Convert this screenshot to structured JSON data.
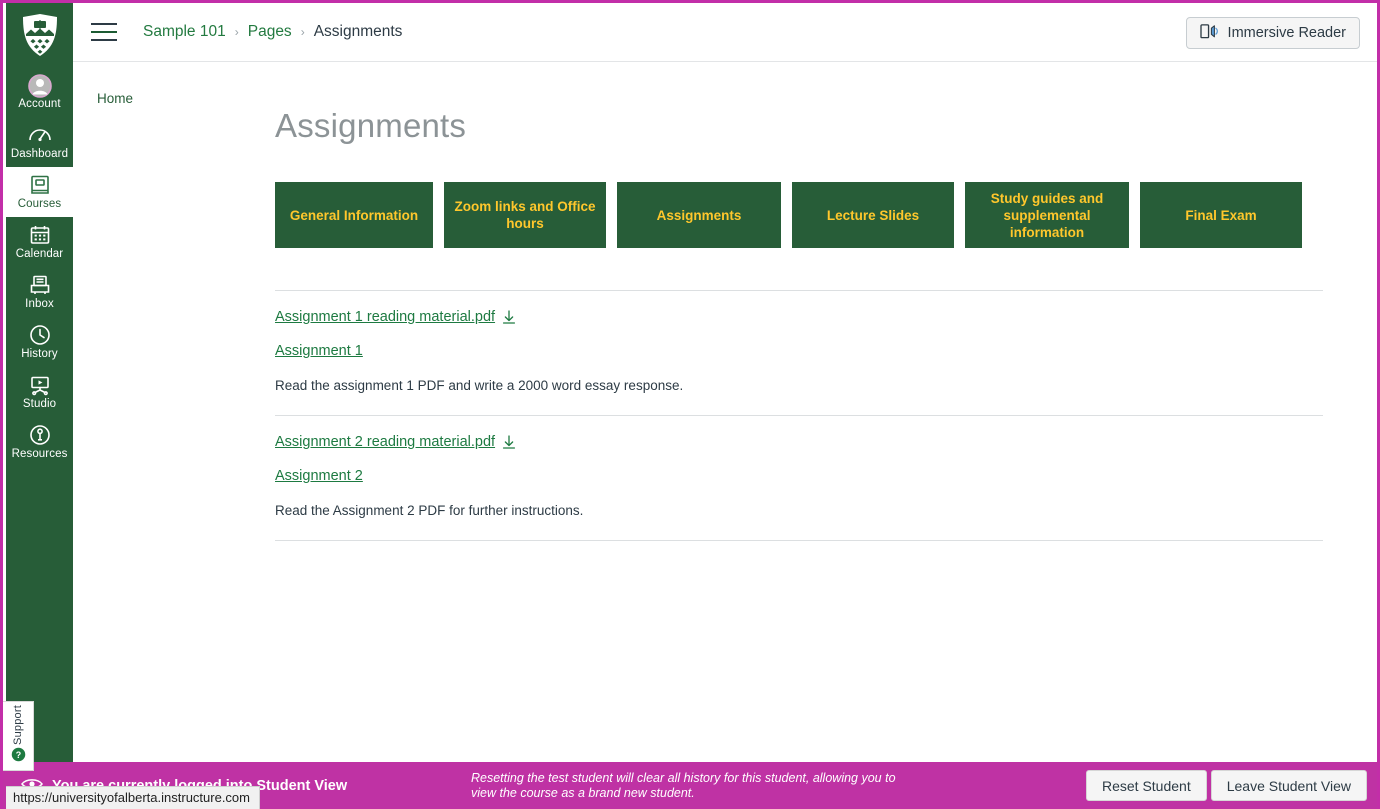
{
  "globalnav": {
    "logo_name": "university-of-alberta-shield",
    "items": [
      {
        "label": "Account",
        "icon": "account-icon",
        "active": false
      },
      {
        "label": "Dashboard",
        "icon": "dashboard-icon",
        "active": false
      },
      {
        "label": "Courses",
        "icon": "courses-icon",
        "active": true
      },
      {
        "label": "Calendar",
        "icon": "calendar-icon",
        "active": false
      },
      {
        "label": "Inbox",
        "icon": "inbox-icon",
        "active": false
      },
      {
        "label": "History",
        "icon": "history-icon",
        "active": false
      },
      {
        "label": "Studio",
        "icon": "studio-icon",
        "active": false
      },
      {
        "label": "Resources",
        "icon": "resources-icon",
        "active": false
      }
    ],
    "support_label": "Support"
  },
  "header": {
    "menu_icon": "hamburger-icon",
    "breadcrumb": [
      {
        "label": "Sample 101",
        "link": true
      },
      {
        "label": "Pages",
        "link": true
      },
      {
        "label": "Assignments",
        "link": false
      }
    ],
    "separator": "›",
    "immersive_reader_label": "Immersive Reader"
  },
  "coursenav": {
    "items": [
      {
        "label": "Home"
      }
    ]
  },
  "main": {
    "title": "Assignments",
    "buttons": [
      {
        "label": "General Information"
      },
      {
        "label": "Zoom links and Office hours"
      },
      {
        "label": "Assignments"
      },
      {
        "label": "Lecture Slides"
      },
      {
        "label": "Study guides and supplemental information"
      },
      {
        "label": "Final Exam"
      }
    ],
    "blocks": [
      {
        "file_label": "Assignment 1 reading material.pdf",
        "assignment_label": "Assignment 1",
        "description": "Read the assignment 1 PDF and write a 2000 word essay response."
      },
      {
        "file_label": "Assignment 2 reading material.pdf",
        "assignment_label": "Assignment 2",
        "description": "Read the Assignment 2 PDF for further instructions."
      }
    ]
  },
  "studentbar": {
    "notice": "You are currently logged into Student View",
    "info": "Resetting the test student will clear all history for this student, allowing you to view the course as a brand new student.",
    "reset_label": "Reset Student",
    "leave_label": "Leave Student View"
  },
  "statusbar": {
    "url": "https://universityofalberta.instructure.com"
  },
  "colors": {
    "brand_green": "#275D38",
    "brand_gold": "#FFC72C",
    "link_green": "#1d7a41",
    "student_view_magenta": "#bf32a4"
  }
}
